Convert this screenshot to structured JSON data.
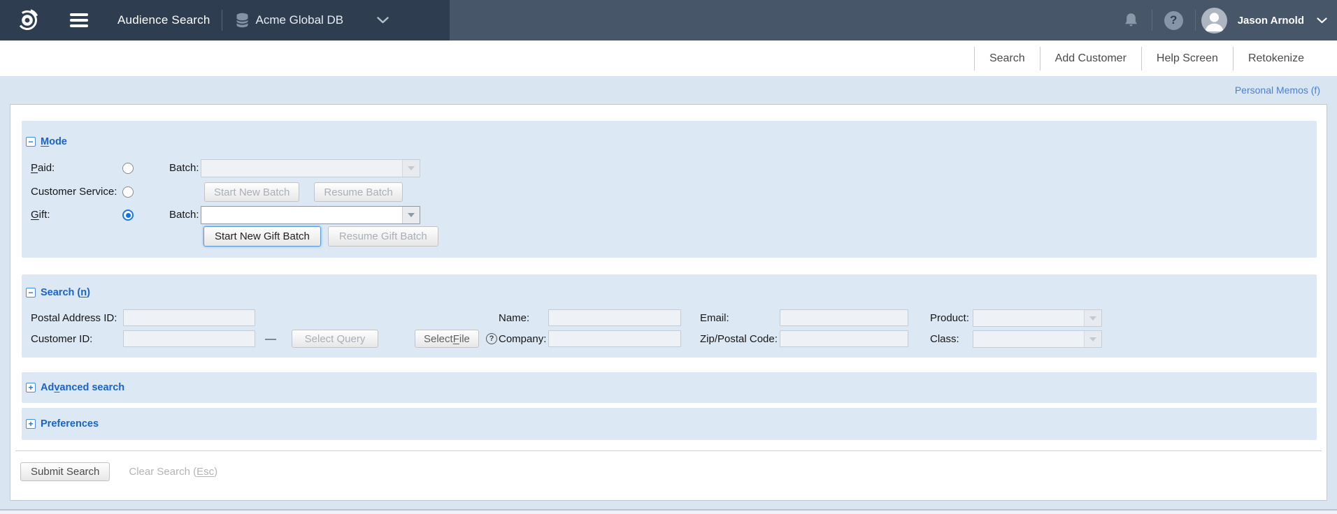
{
  "header": {
    "app_title": "Audience Search",
    "database_name": "Acme Global DB",
    "user_name": "Jason Arnold",
    "help_glyph": "?",
    "icons": [
      "target-logo",
      "hamburger-menu",
      "database",
      "chevron-down",
      "notification-bell",
      "help",
      "user-avatar"
    ]
  },
  "nav": {
    "links": [
      "Search",
      "Add Customer",
      "Help Screen",
      "Retokenize"
    ]
  },
  "memos_link": "Personal Memos (f)",
  "mode": {
    "title": {
      "key": "M",
      "post": "ode"
    },
    "collapse_glyph": "−",
    "rows": {
      "paid": {
        "key": "P",
        "post": "aid:"
      },
      "customer_service": {
        "pre": "Customer Service:"
      },
      "gift": {
        "key": "G",
        "post": "ift:"
      },
      "batch_label": "Batch:",
      "gift_batch_label": "Batch:"
    },
    "buttons": {
      "start_new_batch": "Start New Batch",
      "resume_batch": "Resume Batch",
      "start_new_gift_batch": "Start New Gift Batch",
      "resume_gift_batch": "Resume Gift Batch"
    },
    "selected_mode": "Gift"
  },
  "search": {
    "title": {
      "pre": "Search (",
      "key": "n",
      "post": ")"
    },
    "collapse_glyph": "−",
    "labels": {
      "postal_address_id": "Postal Address ID:",
      "customer_id": "Customer ID:",
      "name": "Name:",
      "company": "Company:",
      "email": "Email:",
      "zip": "Zip/Postal Code:",
      "product": "Product:",
      "class": "Class:"
    },
    "range_dash": "—",
    "select_query": "Select Query",
    "select_file": {
      "pre": "Select ",
      "key": "F",
      "post": "ile"
    },
    "company_help_glyph": "?"
  },
  "advanced_search": {
    "title": {
      "pre": "Ad",
      "key": "v",
      "post": "anced search"
    },
    "expand_glyph": "+"
  },
  "preferences": {
    "title": {
      "pre": "Preferences"
    },
    "expand_glyph": "+"
  },
  "actions": {
    "submit": "Submit Search",
    "clear": {
      "pre": "Clear Search (",
      "key": "Esc",
      "post": ")"
    }
  },
  "colors": {
    "header_left": "#2e3d50",
    "header_right": "#475669",
    "page_background": "#d9e6f2",
    "panel_background": "#dce8f4",
    "section_title_blue": "#1a64c8",
    "link_blue": "#4a7fd4",
    "radio_selected_blue": "#1173e8"
  }
}
